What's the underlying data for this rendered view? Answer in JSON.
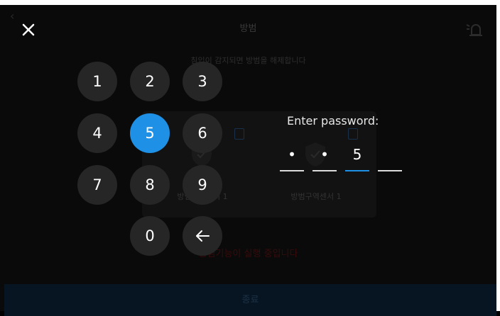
{
  "background_screen": {
    "back_label": "‹",
    "title": "방범",
    "subtitle": "침입이 감지되면 방범을 해제합니다",
    "sensors": [
      {
        "label": "방범구역센서 1"
      },
      {
        "label": "방범구역센서 1"
      }
    ],
    "warning": "방범기능이 실행 중입니다",
    "footer_button": "종료"
  },
  "keypad": {
    "keys": [
      "1",
      "2",
      "3",
      "4",
      "5",
      "6",
      "7",
      "8",
      "9",
      "0"
    ],
    "active_key": "5",
    "backspace_icon": "left-arrow-icon",
    "close_icon": "close-icon"
  },
  "password": {
    "label": "Enter password:",
    "slots": [
      "•",
      "•",
      "5",
      ""
    ],
    "current_index": 2
  },
  "colors": {
    "accent": "#1e90e6",
    "key_background": "#262626",
    "background": "#000000"
  }
}
